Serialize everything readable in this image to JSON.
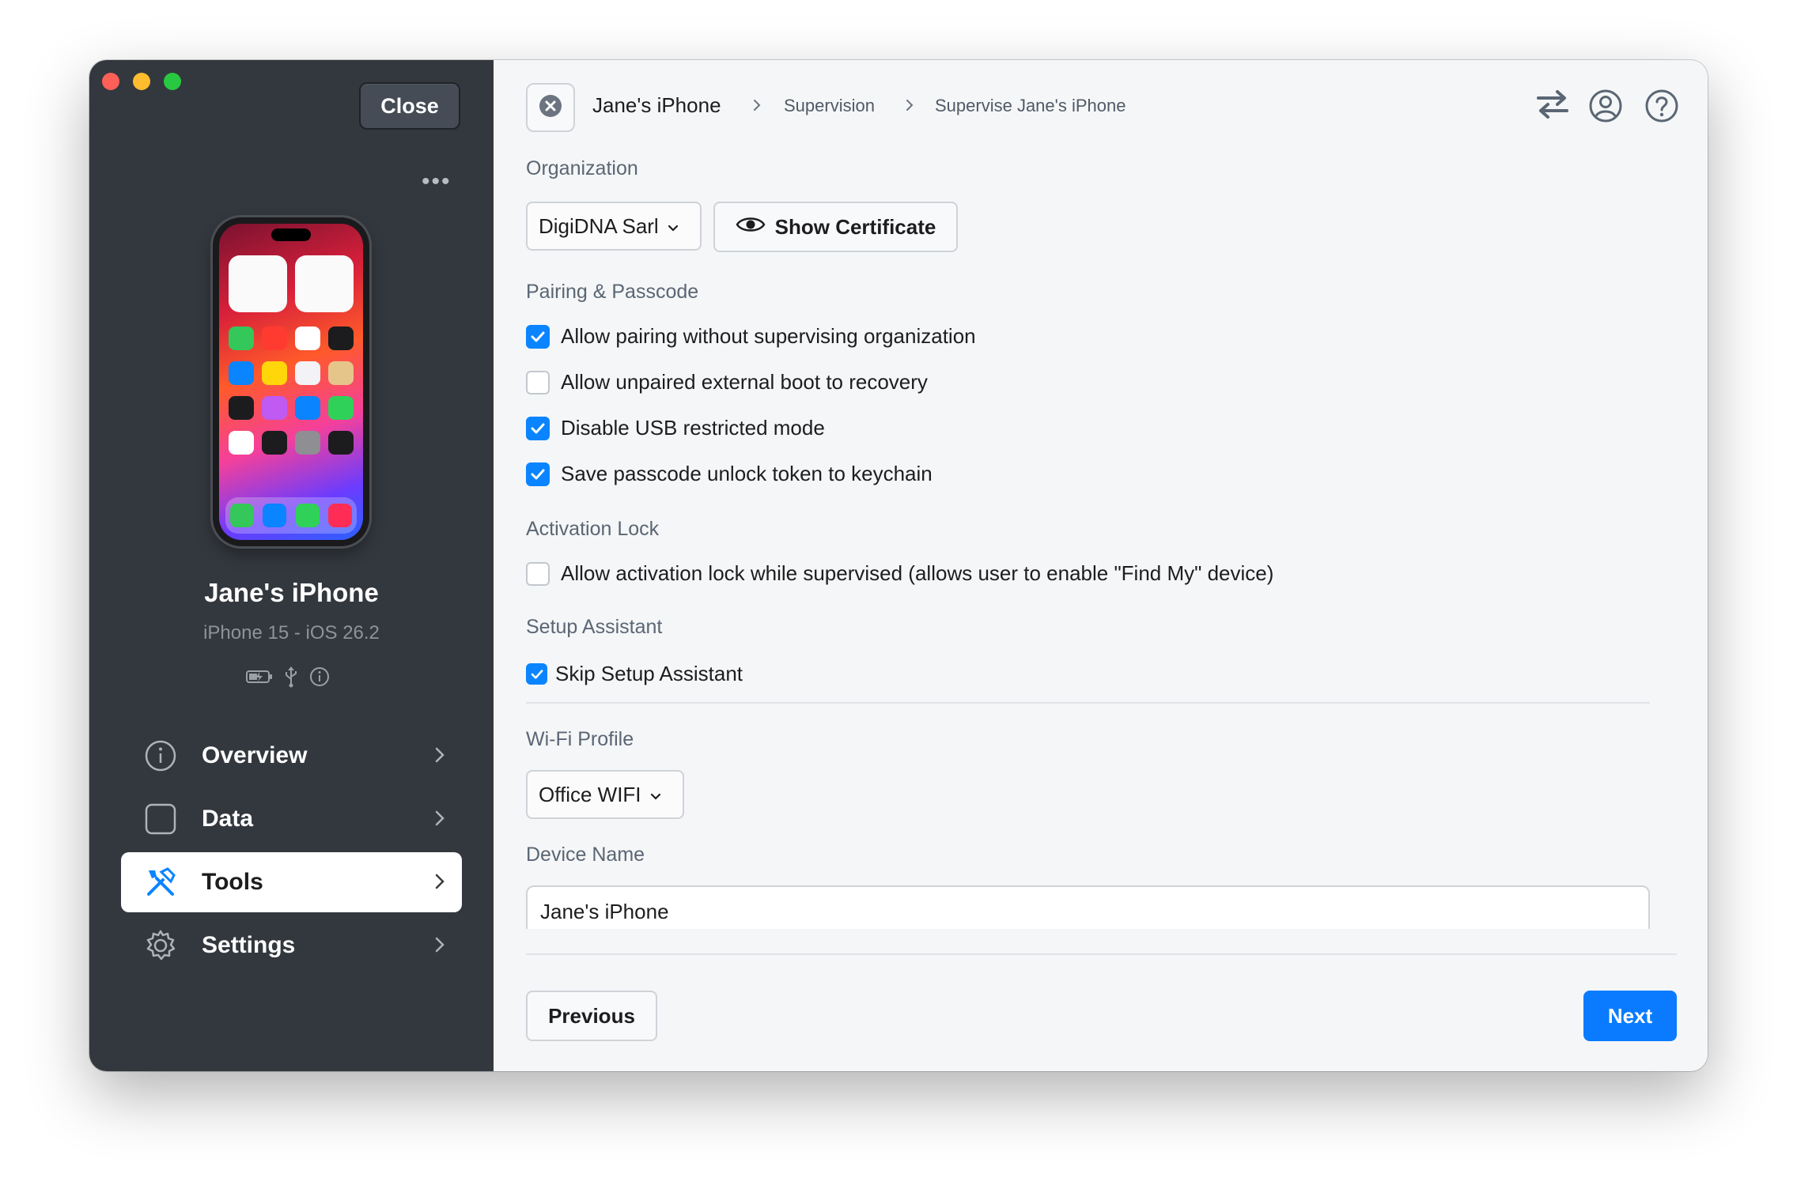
{
  "sidebar": {
    "close_label": "Close",
    "more_label": "•••",
    "device": {
      "name": "Jane's iPhone",
      "model": "iPhone 15 - iOS 26.2"
    },
    "status_icons": [
      "battery-charging-icon",
      "usb-icon",
      "info-icon"
    ],
    "nav": [
      {
        "label": "Overview",
        "icon": "info-circle-icon",
        "active": false
      },
      {
        "label": "Data",
        "icon": "square-icon",
        "active": false
      },
      {
        "label": "Tools",
        "icon": "tools-icon",
        "active": true
      },
      {
        "label": "Settings",
        "icon": "gear-icon",
        "active": false
      }
    ]
  },
  "breadcrumb": {
    "items": [
      "Jane's iPhone",
      "Supervision",
      "Supervise Jane's iPhone"
    ]
  },
  "toolbar_icons": [
    "transfer-icon",
    "account-icon",
    "help-icon"
  ],
  "organization": {
    "label": "Organization",
    "selected": "DigiDNA Sarl",
    "show_certificate_label": "Show Certificate"
  },
  "pairing": {
    "label": "Pairing & Passcode",
    "options": [
      {
        "label": "Allow pairing without supervising organization",
        "checked": true
      },
      {
        "label": "Allow unpaired external boot to recovery",
        "checked": false
      },
      {
        "label": "Disable USB restricted mode",
        "checked": true
      },
      {
        "label": "Save passcode unlock token to keychain",
        "checked": true
      }
    ]
  },
  "activation_lock": {
    "label": "Activation Lock",
    "options": [
      {
        "label": "Allow activation lock while supervised (allows user to enable \"Find My\" device)",
        "checked": false
      }
    ]
  },
  "setup_assistant": {
    "label": "Setup Assistant",
    "options": [
      {
        "label": "Skip Setup Assistant",
        "checked": true
      }
    ]
  },
  "wifi_profile": {
    "label": "Wi-Fi Profile",
    "selected": "Office WIFI"
  },
  "device_name_field": {
    "label": "Device Name",
    "value": "Jane's iPhone"
  },
  "footer": {
    "previous_label": "Previous",
    "next_label": "Next"
  },
  "colors": {
    "accent": "#0a84ff",
    "sidebar_bg": "#33383e",
    "main_bg": "#f5f6f7"
  }
}
